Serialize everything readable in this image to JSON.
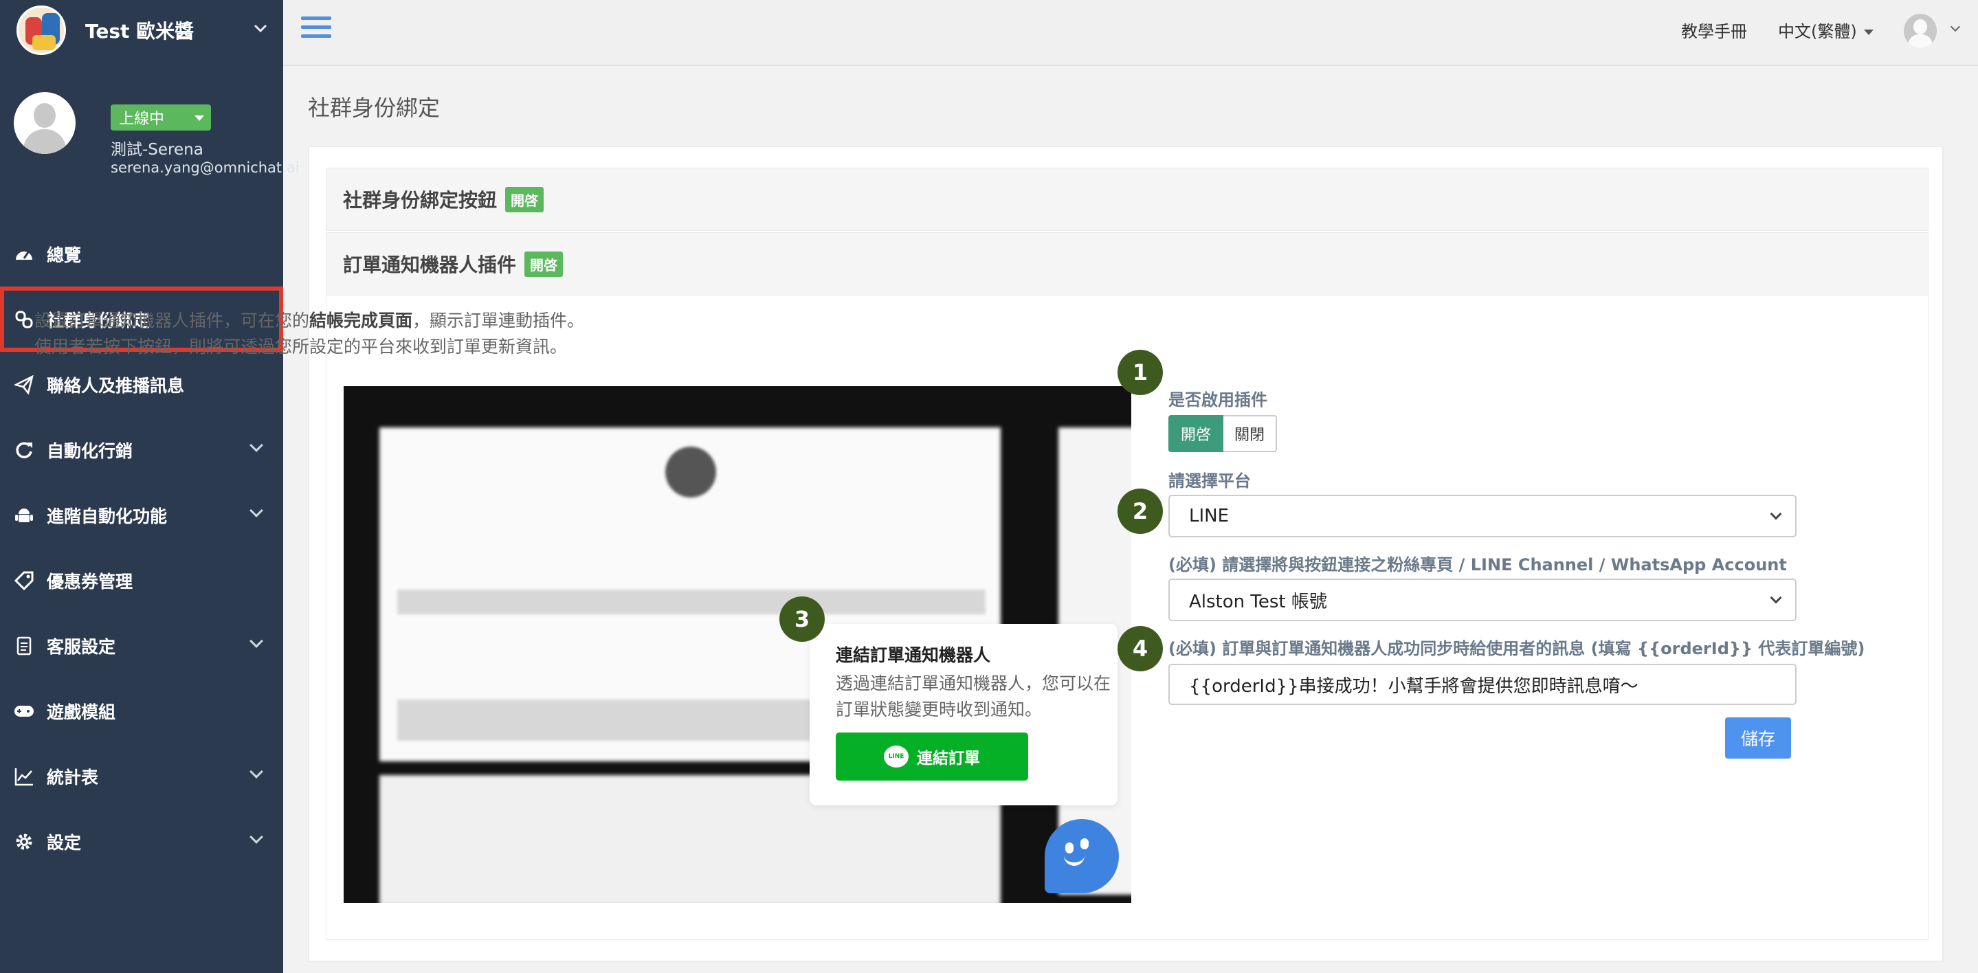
{
  "brand": {
    "name": "Test 歐米醬"
  },
  "profile": {
    "status": "上線中",
    "name": "測試-Serena",
    "email": "serena.yang@omnichat.ai"
  },
  "nav": [
    {
      "label": "總覽",
      "icon": "dashboard-icon"
    },
    {
      "label": "社群身份綁定",
      "icon": "link-icon",
      "active": true
    },
    {
      "label": "聯絡人及推播訊息",
      "icon": "paper-plane-icon"
    },
    {
      "label": "自動化行銷",
      "icon": "refresh-icon",
      "expandable": true
    },
    {
      "label": "進階自動化功能",
      "icon": "android-icon",
      "expandable": true
    },
    {
      "label": "優惠券管理",
      "icon": "tag-icon"
    },
    {
      "label": "客服設定",
      "icon": "document-icon",
      "expandable": true
    },
    {
      "label": "遊戲模組",
      "icon": "gamepad-icon"
    },
    {
      "label": "統計表",
      "icon": "line-chart-icon",
      "expandable": true
    },
    {
      "label": "設定",
      "icon": "gear-icon",
      "expandable": true
    }
  ],
  "topbar": {
    "manual": "教學手冊",
    "language": "中文(繁體)"
  },
  "page": {
    "title": "社群身份綁定"
  },
  "panels": {
    "binding_button": {
      "title": "社群身份綁定按鈕",
      "tag": "開啓"
    },
    "order_bot": {
      "title": "訂單通知機器人插件",
      "tag": "開啓"
    }
  },
  "description": {
    "line1_pre": "設置訂單通知機器人插件，可在您的",
    "line1_bold": "結帳完成頁面",
    "line1_post": "，顯示訂單連動插件。",
    "line2": "使用者若按下按鈕，則將可透過您所設定的平台來收到訂單更新資訊。"
  },
  "preview": {
    "card_title": "連結訂單通知機器人",
    "card_desc": "透過連結訂單通知機器人，您可以在訂單狀態變更時收到通知。",
    "button_label": "連結訂單",
    "line_logo": "LINE"
  },
  "steps": [
    "1",
    "2",
    "3",
    "4"
  ],
  "form": {
    "enable_label": "是否啟用插件",
    "enable_on": "開啓",
    "enable_off": "關閉",
    "enabled": true,
    "platform_label": "請選擇平台",
    "platform_value": "LINE",
    "account_label": "(必填) 請選擇將與按鈕連接之粉絲專頁 / LINE Channel / WhatsApp Account",
    "account_value": "Alston Test 帳號",
    "message_label": "(必填) 訂單與訂單通知機器人成功同步時給使用者的訊息 (填寫 {{orderId}} 代表訂單編號)",
    "message_value": "{{orderId}}串接成功！小幫手將會提供您即時訊息唷～",
    "save_label": "儲存"
  },
  "colors": {
    "sidebar": "#2b3a4f",
    "active_outline": "#e0392b",
    "tag_green": "#5cb85c",
    "line_green": "#06b026",
    "step_circle": "#3e5a1f",
    "primary_blue": "#4f93f0"
  }
}
